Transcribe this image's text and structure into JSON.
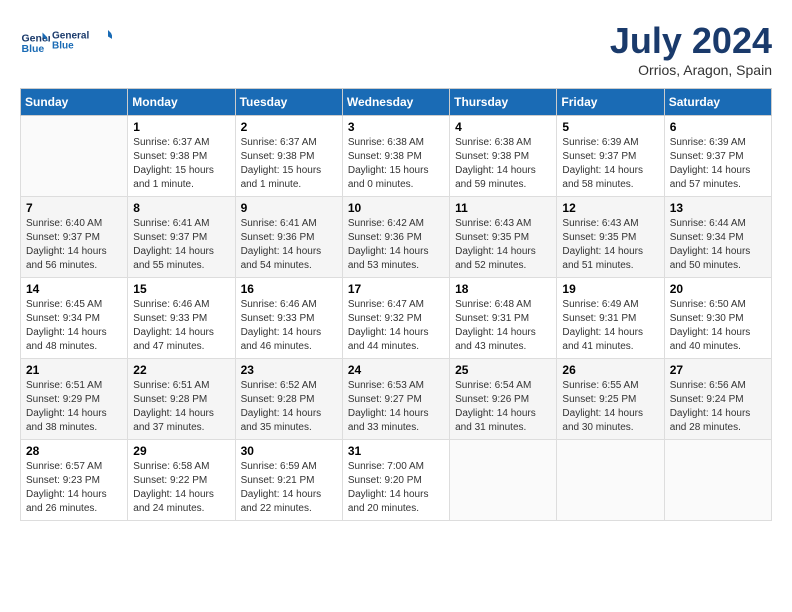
{
  "header": {
    "logo_line1": "General",
    "logo_line2": "Blue",
    "month_title": "July 2024",
    "location": "Orrios, Aragon, Spain"
  },
  "days_of_week": [
    "Sunday",
    "Monday",
    "Tuesday",
    "Wednesday",
    "Thursday",
    "Friday",
    "Saturday"
  ],
  "weeks": [
    [
      {
        "day": "",
        "sunrise": "",
        "sunset": "",
        "daylight": ""
      },
      {
        "day": "1",
        "sunrise": "Sunrise: 6:37 AM",
        "sunset": "Sunset: 9:38 PM",
        "daylight": "Daylight: 15 hours and 1 minute."
      },
      {
        "day": "2",
        "sunrise": "Sunrise: 6:37 AM",
        "sunset": "Sunset: 9:38 PM",
        "daylight": "Daylight: 15 hours and 1 minute."
      },
      {
        "day": "3",
        "sunrise": "Sunrise: 6:38 AM",
        "sunset": "Sunset: 9:38 PM",
        "daylight": "Daylight: 15 hours and 0 minutes."
      },
      {
        "day": "4",
        "sunrise": "Sunrise: 6:38 AM",
        "sunset": "Sunset: 9:38 PM",
        "daylight": "Daylight: 14 hours and 59 minutes."
      },
      {
        "day": "5",
        "sunrise": "Sunrise: 6:39 AM",
        "sunset": "Sunset: 9:37 PM",
        "daylight": "Daylight: 14 hours and 58 minutes."
      },
      {
        "day": "6",
        "sunrise": "Sunrise: 6:39 AM",
        "sunset": "Sunset: 9:37 PM",
        "daylight": "Daylight: 14 hours and 57 minutes."
      }
    ],
    [
      {
        "day": "7",
        "sunrise": "Sunrise: 6:40 AM",
        "sunset": "Sunset: 9:37 PM",
        "daylight": "Daylight: 14 hours and 56 minutes."
      },
      {
        "day": "8",
        "sunrise": "Sunrise: 6:41 AM",
        "sunset": "Sunset: 9:37 PM",
        "daylight": "Daylight: 14 hours and 55 minutes."
      },
      {
        "day": "9",
        "sunrise": "Sunrise: 6:41 AM",
        "sunset": "Sunset: 9:36 PM",
        "daylight": "Daylight: 14 hours and 54 minutes."
      },
      {
        "day": "10",
        "sunrise": "Sunrise: 6:42 AM",
        "sunset": "Sunset: 9:36 PM",
        "daylight": "Daylight: 14 hours and 53 minutes."
      },
      {
        "day": "11",
        "sunrise": "Sunrise: 6:43 AM",
        "sunset": "Sunset: 9:35 PM",
        "daylight": "Daylight: 14 hours and 52 minutes."
      },
      {
        "day": "12",
        "sunrise": "Sunrise: 6:43 AM",
        "sunset": "Sunset: 9:35 PM",
        "daylight": "Daylight: 14 hours and 51 minutes."
      },
      {
        "day": "13",
        "sunrise": "Sunrise: 6:44 AM",
        "sunset": "Sunset: 9:34 PM",
        "daylight": "Daylight: 14 hours and 50 minutes."
      }
    ],
    [
      {
        "day": "14",
        "sunrise": "Sunrise: 6:45 AM",
        "sunset": "Sunset: 9:34 PM",
        "daylight": "Daylight: 14 hours and 48 minutes."
      },
      {
        "day": "15",
        "sunrise": "Sunrise: 6:46 AM",
        "sunset": "Sunset: 9:33 PM",
        "daylight": "Daylight: 14 hours and 47 minutes."
      },
      {
        "day": "16",
        "sunrise": "Sunrise: 6:46 AM",
        "sunset": "Sunset: 9:33 PM",
        "daylight": "Daylight: 14 hours and 46 minutes."
      },
      {
        "day": "17",
        "sunrise": "Sunrise: 6:47 AM",
        "sunset": "Sunset: 9:32 PM",
        "daylight": "Daylight: 14 hours and 44 minutes."
      },
      {
        "day": "18",
        "sunrise": "Sunrise: 6:48 AM",
        "sunset": "Sunset: 9:31 PM",
        "daylight": "Daylight: 14 hours and 43 minutes."
      },
      {
        "day": "19",
        "sunrise": "Sunrise: 6:49 AM",
        "sunset": "Sunset: 9:31 PM",
        "daylight": "Daylight: 14 hours and 41 minutes."
      },
      {
        "day": "20",
        "sunrise": "Sunrise: 6:50 AM",
        "sunset": "Sunset: 9:30 PM",
        "daylight": "Daylight: 14 hours and 40 minutes."
      }
    ],
    [
      {
        "day": "21",
        "sunrise": "Sunrise: 6:51 AM",
        "sunset": "Sunset: 9:29 PM",
        "daylight": "Daylight: 14 hours and 38 minutes."
      },
      {
        "day": "22",
        "sunrise": "Sunrise: 6:51 AM",
        "sunset": "Sunset: 9:28 PM",
        "daylight": "Daylight: 14 hours and 37 minutes."
      },
      {
        "day": "23",
        "sunrise": "Sunrise: 6:52 AM",
        "sunset": "Sunset: 9:28 PM",
        "daylight": "Daylight: 14 hours and 35 minutes."
      },
      {
        "day": "24",
        "sunrise": "Sunrise: 6:53 AM",
        "sunset": "Sunset: 9:27 PM",
        "daylight": "Daylight: 14 hours and 33 minutes."
      },
      {
        "day": "25",
        "sunrise": "Sunrise: 6:54 AM",
        "sunset": "Sunset: 9:26 PM",
        "daylight": "Daylight: 14 hours and 31 minutes."
      },
      {
        "day": "26",
        "sunrise": "Sunrise: 6:55 AM",
        "sunset": "Sunset: 9:25 PM",
        "daylight": "Daylight: 14 hours and 30 minutes."
      },
      {
        "day": "27",
        "sunrise": "Sunrise: 6:56 AM",
        "sunset": "Sunset: 9:24 PM",
        "daylight": "Daylight: 14 hours and 28 minutes."
      }
    ],
    [
      {
        "day": "28",
        "sunrise": "Sunrise: 6:57 AM",
        "sunset": "Sunset: 9:23 PM",
        "daylight": "Daylight: 14 hours and 26 minutes."
      },
      {
        "day": "29",
        "sunrise": "Sunrise: 6:58 AM",
        "sunset": "Sunset: 9:22 PM",
        "daylight": "Daylight: 14 hours and 24 minutes."
      },
      {
        "day": "30",
        "sunrise": "Sunrise: 6:59 AM",
        "sunset": "Sunset: 9:21 PM",
        "daylight": "Daylight: 14 hours and 22 minutes."
      },
      {
        "day": "31",
        "sunrise": "Sunrise: 7:00 AM",
        "sunset": "Sunset: 9:20 PM",
        "daylight": "Daylight: 14 hours and 20 minutes."
      },
      {
        "day": "",
        "sunrise": "",
        "sunset": "",
        "daylight": ""
      },
      {
        "day": "",
        "sunrise": "",
        "sunset": "",
        "daylight": ""
      },
      {
        "day": "",
        "sunrise": "",
        "sunset": "",
        "daylight": ""
      }
    ]
  ]
}
